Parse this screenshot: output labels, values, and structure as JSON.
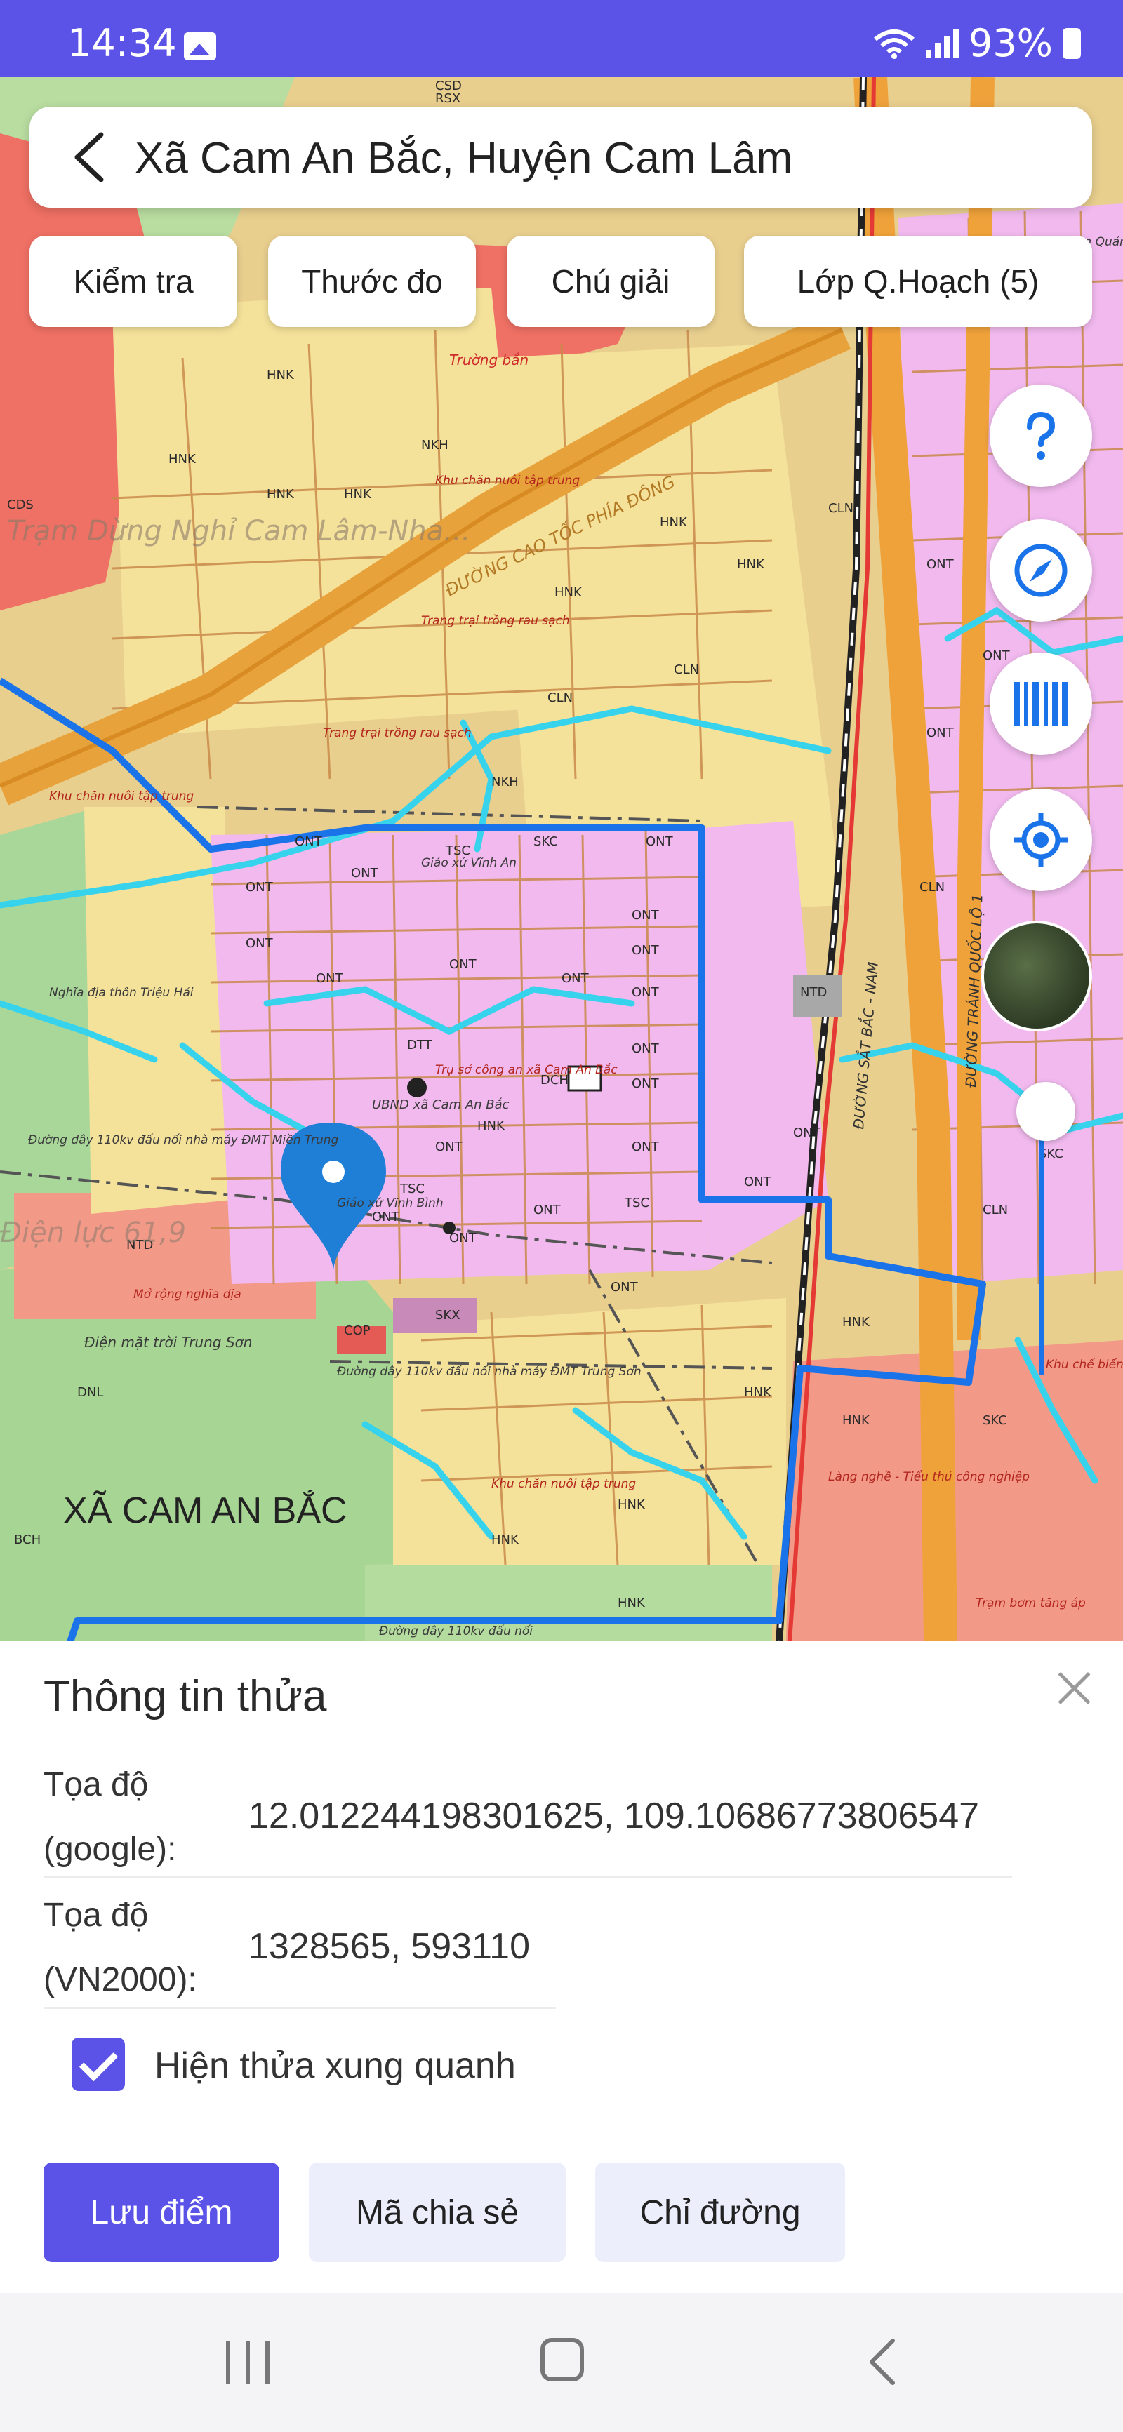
{
  "status_bar": {
    "time": "14:34",
    "battery": "93%"
  },
  "header": {
    "title": "Xã Cam An Bắc, Huyện Cam Lâm"
  },
  "toolbar": {
    "chips": [
      "Kiểm tra",
      "Thước đo",
      "Chú giải",
      "Lớp Q.Hoạch (5)"
    ]
  },
  "map": {
    "commune_label": "XÃ CAM AN BẮC",
    "labels": {
      "hnk": "HNK",
      "ont": "ONT",
      "cln": "CLN",
      "nkh": "NKH",
      "tsc": "TSC",
      "skc": "SKC",
      "ntd": "NTD",
      "dch": "DCH",
      "dtt": "DTT",
      "dnl": "DNL",
      "cop": "COP",
      "skx": "SKX",
      "bch": "BCH",
      "cds": "CDS",
      "csd": "CSD",
      "rsx": "RSX",
      "truong_ban": "Trường bắn",
      "road_label": "ĐƯỜNG CAO TỐC PHÍA ĐÔNG",
      "ubnd": "UBND xã Cam An Bắc",
      "tru_so": "Trụ sở công an xã Cam An Bắc",
      "giao_xu": "Giáo xứ Vĩnh An",
      "giao_xu_vinh_binh": "Giáo xứ Vĩnh Bình",
      "nghia_dia": "Nghĩa địa thôn Triệu Hải",
      "dien_mat_troi": "Điện mặt trời Trung Sơn",
      "mo_rong": "Mở rộng nghĩa địa",
      "khu_chan_nuoi": "Khu chăn nuôi tập trung",
      "trang_trai": "Trang trại trồng rau sạch",
      "duong_day_1": "Đường dây 110kv đấu nối nhà máy ĐMT Miền Trung",
      "duong_day_2": "Đường dây 110kv đấu nối nhà máy ĐMT Trung Sơn",
      "duong_day_3": "Đường dây 110kv đấu nối",
      "duong_sat": "ĐƯỜNG SẮT BẮC - NAM",
      "quoc_lo": "ĐƯỜNG TRÁNH QUỐC LỘ 1",
      "lang_nghe": "Làng nghề - Tiểu thủ công nghiệp",
      "khu_che_bien": "Khu chế biến tập trung",
      "tram_bom": "Trạm bơm tăng áp",
      "tram_dung_nghi": "Trạm Dừng Nghỉ Cam Lâm-Nha...",
      "ts_thon": "TS thôn Quảng Đức",
      "dien_luc": "Điện lực 61,9"
    }
  },
  "sheet": {
    "title": "Thông tin thửa",
    "google_label_1": "Tọa độ",
    "google_label_2": "(google):",
    "google_value": "12.012244198301625, 109.10686773806547",
    "vn2000_label_1": "Tọa độ",
    "vn2000_label_2": "(VN2000):",
    "vn2000_value": "1328565, 593110",
    "checkbox_label": "Hiện thửa xung quanh",
    "buttons": {
      "save": "Lưu điểm",
      "share": "Mã chia sẻ",
      "directions": "Chỉ đường"
    }
  },
  "colors": {
    "accent": "#5b52e8",
    "residential": "#f1b9ee",
    "agri": "#f4e19a",
    "industrial": "#f29988",
    "boundary": "#1a73e8",
    "river": "#37d3ec"
  }
}
